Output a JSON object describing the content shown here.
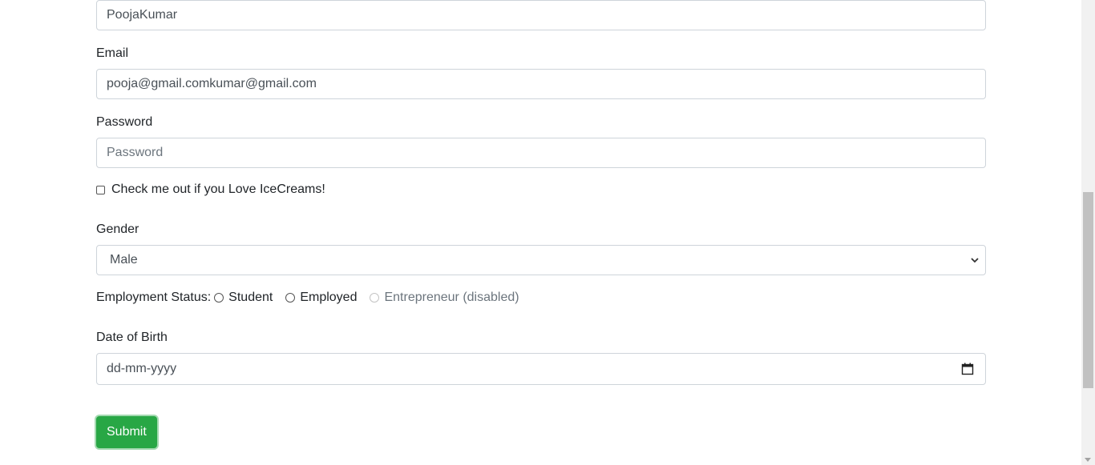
{
  "form": {
    "name_value": "PoojaKumar",
    "email_label": "Email",
    "email_value": "pooja@gmail.comkumar@gmail.com",
    "password_label": "Password",
    "password_placeholder": "Password",
    "checkbox_label": "Check me out if you Love IceCreams!",
    "gender_label": "Gender",
    "gender_selected": "Male",
    "employment_label": "Employment Status:",
    "employment_options": [
      {
        "label": "Student",
        "disabled": false
      },
      {
        "label": "Employed",
        "disabled": false
      },
      {
        "label": "Entrepreneur (disabled)",
        "disabled": true
      }
    ],
    "dob_label": "Date of Birth",
    "dob_placeholder": "dd-mm-yyyy",
    "submit_label": "Submit"
  },
  "colors": {
    "submit_bg": "#28a745",
    "input_border": "#ced4da"
  },
  "icons": {
    "select_chevron": "chevron-down-icon",
    "date_picker": "calendar-icon"
  }
}
